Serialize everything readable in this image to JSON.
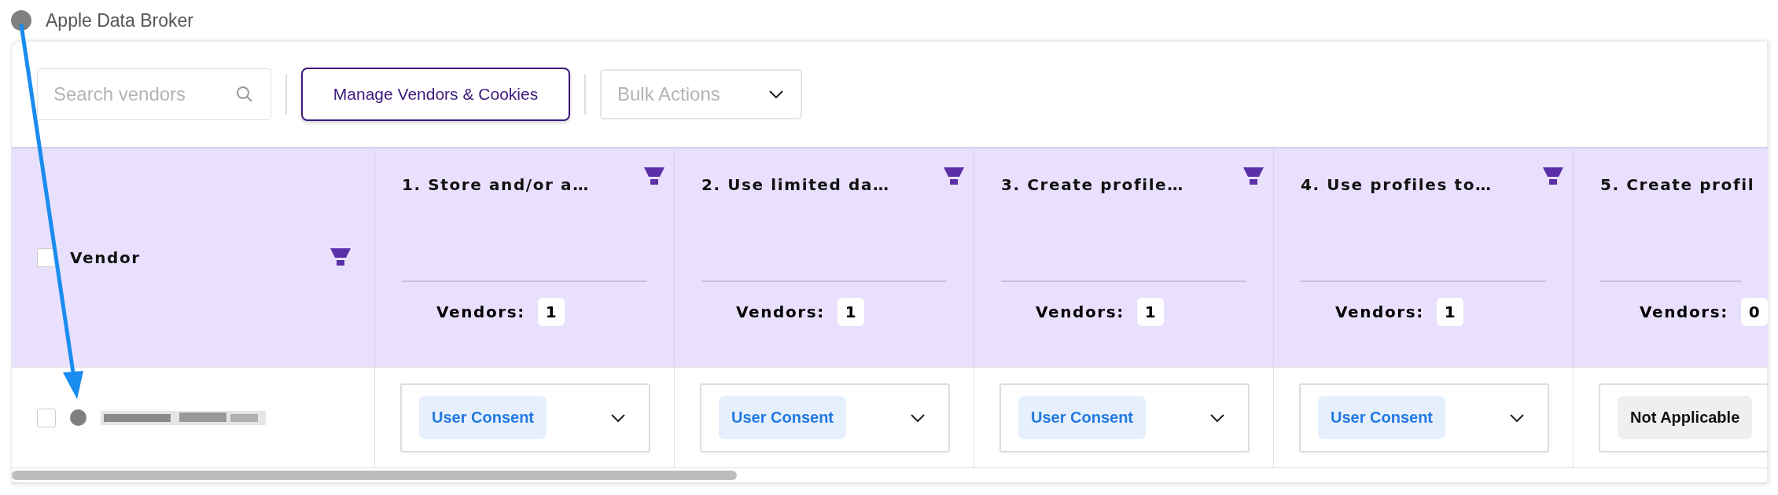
{
  "broker": {
    "name": "Apple Data Broker",
    "color": "#808080"
  },
  "toolbar": {
    "search": {
      "placeholder": "Search vendors"
    },
    "manage_button": "Manage Vendors & Cookies",
    "bulk_actions": {
      "placeholder": "Bulk Actions"
    }
  },
  "table": {
    "vendor_column": {
      "title": "Vendor",
      "checked": false
    },
    "columns": [
      {
        "title": "1. Store and/or a…",
        "filter_icon": true,
        "vendors_label": "Vendors:",
        "vendors_count": "1"
      },
      {
        "title": "2. Use limited da…",
        "filter_icon": true,
        "vendors_label": "Vendors:",
        "vendors_count": "1"
      },
      {
        "title": "3. Create profile…",
        "filter_icon": true,
        "vendors_label": "Vendors:",
        "vendors_count": "1"
      },
      {
        "title": "4. Use profiles to…",
        "filter_icon": true,
        "vendors_label": "Vendors:",
        "vendors_count": "1"
      },
      {
        "title": "5. Create profil",
        "filter_icon": false,
        "vendors_label": "Vendors:",
        "vendors_count": "0"
      }
    ],
    "rows": [
      {
        "checked": false,
        "color": "#808080",
        "cells": [
          {
            "kind": "consent",
            "label": "User Consent",
            "chevron": true
          },
          {
            "kind": "consent",
            "label": "User Consent",
            "chevron": true
          },
          {
            "kind": "consent",
            "label": "User Consent",
            "chevron": true
          },
          {
            "kind": "consent",
            "label": "User Consent",
            "chevron": true
          },
          {
            "kind": "not_applicable",
            "label": "Not Applicable",
            "chevron": false
          }
        ]
      }
    ]
  }
}
